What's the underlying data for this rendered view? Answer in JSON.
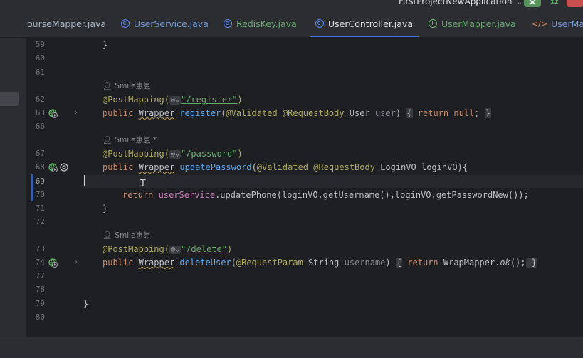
{
  "window": {
    "project_name": "FirstProjectNewApplication"
  },
  "tabs": [
    {
      "label": "ourseMapper.java",
      "icon": "none",
      "color": "#a9b7c6"
    },
    {
      "label": "UserService.java",
      "icon": "interface-icon",
      "color": "#6f9ad8"
    },
    {
      "label": "RedisKey.java",
      "icon": "interface-icon",
      "color": "#6aab73"
    },
    {
      "label": "UserController.java",
      "icon": "class-icon",
      "color": "#dfe1e5",
      "active": true
    },
    {
      "label": "UserMapper.java",
      "icon": "mapper-icon",
      "color": "#6aab73"
    },
    {
      "label": "UserMapp",
      "icon": "xml-icon",
      "color": "#6f9ad8"
    }
  ],
  "line_numbers": [
    "59",
    "60",
    "61",
    "62",
    "63",
    "66",
    "67",
    "68",
    "69",
    "70",
    "71",
    "72",
    "73",
    "74",
    "77",
    "78",
    "79",
    "80"
  ],
  "authors": {
    "register": "Smile崽崽",
    "password": "Smile崽崽 *",
    "delete": "Smile崽崽"
  },
  "code": {
    "l59": "}",
    "register_ann": "@PostMapping(",
    "register_path": "\"/register\"",
    "register_close": ")",
    "register_public": "public ",
    "register_type": "Wrapper",
    "register_name": "register",
    "register_open": "(",
    "register_validated": "@Validated @RequestBody",
    "register_usertype": " User ",
    "register_param": "user",
    "register_rest": ") ",
    "register_fold_l": "{",
    "register_return": " return ",
    "register_null": "null",
    "register_semi": "; ",
    "register_fold_r": "}",
    "pwd_ann": "@PostMapping(",
    "pwd_path": "\"/password\"",
    "pwd_close": ")",
    "pwd_public": "public ",
    "pwd_type": "Wrapper",
    "pwd_name": "updatePassword",
    "pwd_open": "(",
    "pwd_validated": "@Validated @RequestBody",
    "pwd_rest": " LoginVO loginVO){",
    "l70_return": "return ",
    "l70_field": "userService",
    "l70_rest": ".updatePhone(loginVO.getUsername(),loginVO.getPasswordNew());",
    "l71": "}",
    "del_ann": "@PostMapping(",
    "del_path": "\"/delete\"",
    "del_close": ")",
    "del_public": "public ",
    "del_type": "Wrapper",
    "del_name": "deleteUser",
    "del_open": "(",
    "del_reqparam": "@RequestParam",
    "del_stringtype": " String ",
    "del_param": "username",
    "del_rest": ") ",
    "del_fold_l": "{",
    "del_return": " return ",
    "del_call": "WrapMapper.",
    "del_ok": "ok",
    "del_end": "();",
    "del_fold_r": " }",
    "l79": "}"
  },
  "inlay_hint": "◎⌄",
  "colors": {
    "accent": "#3574f0",
    "keyword": "#cf8e6d",
    "annotation": "#b3ae60",
    "string": "#6aab73",
    "method": "#57aaf7",
    "field": "#c77dbb",
    "background": "#1e1f22"
  }
}
